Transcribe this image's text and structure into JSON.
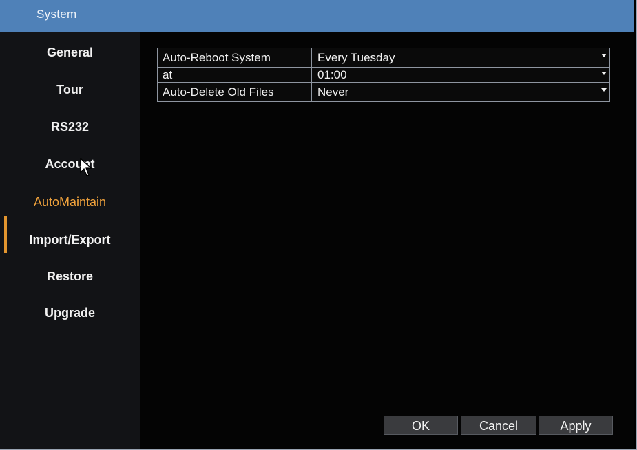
{
  "window": {
    "title": "System"
  },
  "sidebar": {
    "items": [
      {
        "label": "General",
        "active": false
      },
      {
        "label": "Tour",
        "active": false
      },
      {
        "label": "RS232",
        "active": false
      },
      {
        "label": "Account",
        "active": false
      },
      {
        "label": "AutoMaintain",
        "active": true
      },
      {
        "label": "Import/Export",
        "active": false
      },
      {
        "label": "Restore",
        "active": false
      },
      {
        "label": "Upgrade",
        "active": false
      }
    ]
  },
  "settings": {
    "rows": [
      {
        "label": "Auto-Reboot System",
        "value": "Every Tuesday"
      },
      {
        "label": "at",
        "value": "01:00"
      },
      {
        "label": "Auto-Delete Old Files",
        "value": "Never"
      }
    ]
  },
  "buttons": {
    "ok": "OK",
    "cancel": "Cancel",
    "apply": "Apply"
  },
  "colors": {
    "titlebar": "#4f81b8",
    "accent": "#f0a23c",
    "background": "#000000"
  }
}
